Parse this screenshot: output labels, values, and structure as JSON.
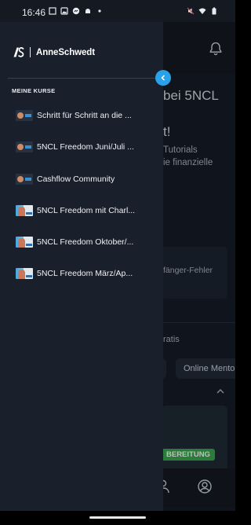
{
  "status_bar": {
    "time": "16:46",
    "left_icons": [
      "window-icon",
      "gallery-icon",
      "messenger-icon",
      "android-icon",
      "dot-icon"
    ],
    "right_icons": [
      "mute-icon",
      "wifi-icon",
      "battery-icon"
    ]
  },
  "drawer": {
    "brand_name": "AnneSchwedt",
    "section_label": "MEINE KURSE",
    "courses": [
      {
        "label": "Schritt für Schritt an die ...",
        "thumb": "dark"
      },
      {
        "label": "5NCL Freedom Juni/Juli ...",
        "thumb": "dark"
      },
      {
        "label": "Cashflow Community",
        "thumb": "dark"
      },
      {
        "label": "5NCL Freedom mit Charl...",
        "thumb": "photo"
      },
      {
        "label": "5NCL Freedom Oktober/...",
        "thumb": "photo"
      },
      {
        "label": "5NCL Freedom März/Ap...",
        "thumb": "photo"
      }
    ]
  },
  "background": {
    "title": "bei 5NCL",
    "line2": "t!",
    "desc_line1": "Tutorials",
    "desc_line2": "ie finanzielle",
    "card_text": "fänger-Fehler",
    "gratis": "ratis",
    "chip_right": "Online Mentor",
    "banner_tag": "BEREITUNG"
  },
  "colors": {
    "drawer_bg": "#1a202b",
    "accent": "#2aa2e8",
    "banner_green": "#37a64d"
  }
}
